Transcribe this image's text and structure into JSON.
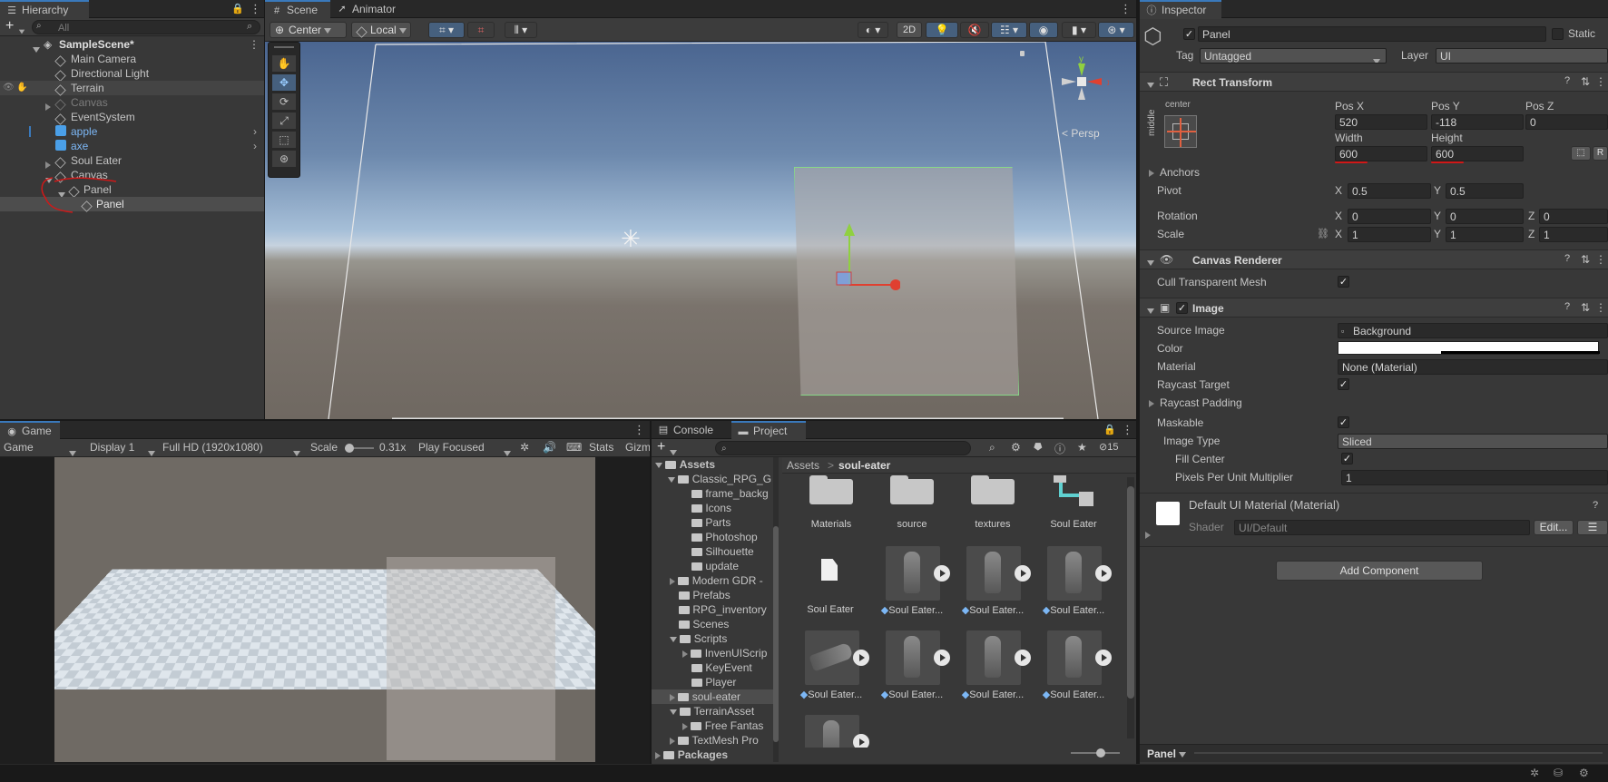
{
  "hierarchy": {
    "tab": "Hierarchy",
    "search_placeholder": "All",
    "scene": "SampleScene*",
    "items": [
      {
        "label": "Main Camera",
        "indent": 1
      },
      {
        "label": "Directional Light",
        "indent": 1
      },
      {
        "label": "Terrain",
        "indent": 1
      },
      {
        "label": "Canvas",
        "indent": 1
      },
      {
        "label": "EventSystem",
        "indent": 1
      },
      {
        "label": "apple",
        "indent": 1
      },
      {
        "label": "axe",
        "indent": 1
      },
      {
        "label": "Soul Eater",
        "indent": 1
      },
      {
        "label": "Canvas",
        "indent": 1
      },
      {
        "label": "Panel",
        "indent": 2
      },
      {
        "label": "Panel",
        "indent": 3
      }
    ]
  },
  "scene": {
    "tab_scene": "Scene",
    "tab_animator": "Animator",
    "pivot": "Center",
    "space": "Local",
    "mode2d": "2D",
    "persp": "Persp",
    "axis_x": "x",
    "axis_y": "y"
  },
  "game": {
    "tab": "Game",
    "view": "Game",
    "display": "Display 1",
    "resolution": "Full HD (1920x1080)",
    "scale_label": "Scale",
    "scale_value": "0.31x",
    "play_mode": "Play Focused",
    "stats": "Stats",
    "gizmos": "Gizm"
  },
  "project": {
    "tab_console": "Console",
    "tab_project": "Project",
    "count": "15",
    "breadcrumb_root": "Assets",
    "breadcrumb_sep": ">",
    "breadcrumb_current": "soul-eater",
    "tree": [
      {
        "label": "Assets",
        "bold": true
      },
      {
        "label": "Classic_RPG_G"
      },
      {
        "label": "frame_backg"
      },
      {
        "label": "Icons"
      },
      {
        "label": "Parts"
      },
      {
        "label": "Photoshop"
      },
      {
        "label": "Silhouette"
      },
      {
        "label": "update"
      },
      {
        "label": "Modern GDR -"
      },
      {
        "label": "Prefabs"
      },
      {
        "label": "RPG_inventory"
      },
      {
        "label": "Scenes"
      },
      {
        "label": "Scripts"
      },
      {
        "label": "InvenUIScrip"
      },
      {
        "label": "KeyEvent"
      },
      {
        "label": "Player"
      },
      {
        "label": "soul-eater"
      },
      {
        "label": "TerrainAsset"
      },
      {
        "label": "Free Fantas"
      },
      {
        "label": "TextMesh Pro"
      },
      {
        "label": "Packages",
        "bold": true
      }
    ],
    "assets": [
      {
        "label": "Materials"
      },
      {
        "label": "source"
      },
      {
        "label": "textures"
      },
      {
        "label": "Soul Eater"
      },
      {
        "label": "Soul Eater"
      },
      {
        "label": "Soul Eater..."
      },
      {
        "label": "Soul Eater..."
      },
      {
        "label": "Soul Eater..."
      },
      {
        "label": "Soul Eater..."
      },
      {
        "label": "Soul Eater..."
      },
      {
        "label": "Soul Eater..."
      },
      {
        "label": "Soul Eater..."
      }
    ]
  },
  "inspector": {
    "tab": "Inspector",
    "name": "Panel",
    "static": "Static",
    "tag_label": "Tag",
    "tag": "Untagged",
    "layer_label": "Layer",
    "layer": "UI",
    "rect": {
      "title": "Rect Transform",
      "anchor_top": "center",
      "anchor_side": "middle",
      "posx_label": "Pos X",
      "posy_label": "Pos Y",
      "posz_label": "Pos Z",
      "posx": "520",
      "posy": "-118",
      "posz": "0",
      "width_label": "Width",
      "height_label": "Height",
      "width": "600",
      "height": "600",
      "anchors": "Anchors",
      "pivot": "Pivot",
      "pivot_x": "0.5",
      "pivot_y": "0.5",
      "rotation": "Rotation",
      "rot_x": "0",
      "rot_y": "0",
      "rot_z": "0",
      "scale": "Scale",
      "scale_x": "1",
      "scale_y": "1",
      "scale_z": "1",
      "x": "X",
      "y": "Y",
      "z": "Z",
      "r": "R"
    },
    "canvas_renderer": {
      "title": "Canvas Renderer",
      "cull": "Cull Transparent Mesh"
    },
    "image": {
      "title": "Image",
      "source_label": "Source Image",
      "source": "Background",
      "color_label": "Color",
      "material_label": "Material",
      "material": "None (Material)",
      "raycast_target": "Raycast Target",
      "raycast_padding": "Raycast Padding",
      "maskable": "Maskable",
      "image_type_label": "Image Type",
      "image_type": "Sliced",
      "fill_center": "Fill Center",
      "ppu_label": "Pixels Per Unit Multiplier",
      "ppu": "1"
    },
    "material": {
      "title": "Default UI Material (Material)",
      "shader_label": "Shader",
      "shader": "UI/Default",
      "edit": "Edit..."
    },
    "add_component": "Add Component",
    "footer": "Panel"
  },
  "colors": {
    "accent": "#3a79bb",
    "prefab_blue": "#7cb7f5",
    "annotation_red": "#d01818",
    "selection": "#4d4d4d"
  }
}
